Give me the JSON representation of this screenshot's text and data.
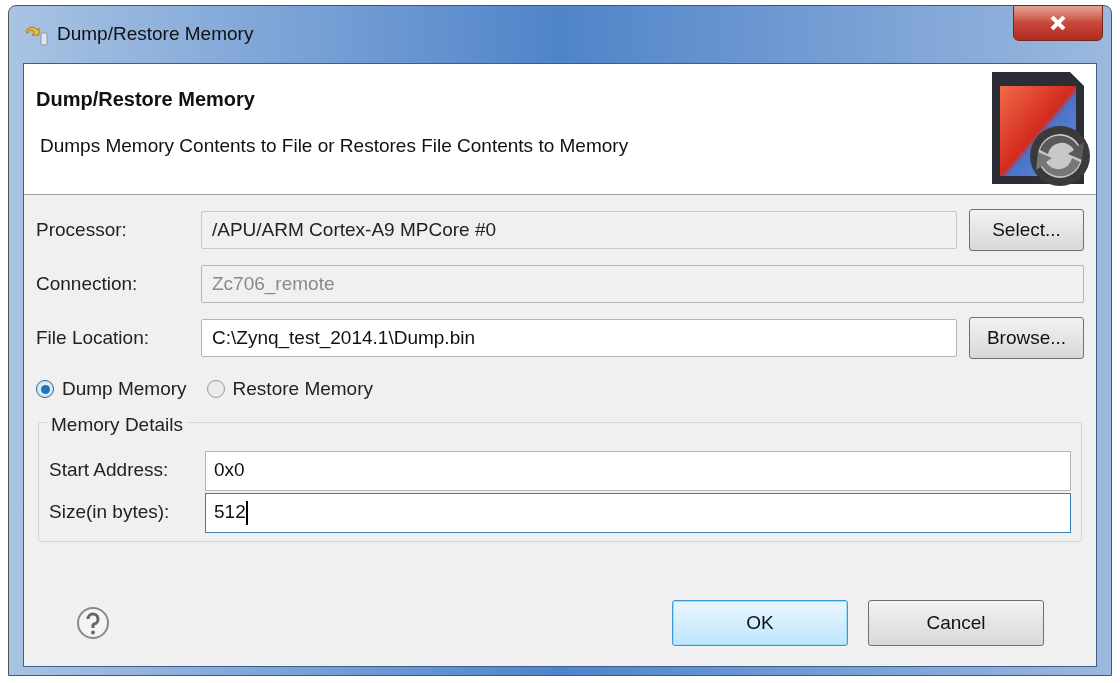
{
  "window": {
    "title": "Dump/Restore Memory"
  },
  "header": {
    "title": "Dump/Restore Memory",
    "description": "Dumps Memory Contents to File or Restores File Contents to Memory"
  },
  "fields": [
    {
      "label": "Processor:",
      "value": "/APU/ARM Cortex-A9 MPCore #0",
      "kind": "readonly",
      "button": "Select..."
    },
    {
      "label": "Connection:",
      "value": "Zc706_remote",
      "kind": "disabled"
    },
    {
      "label": "File Location:",
      "value": "C:\\Zynq_test_2014.1\\Dump.bin",
      "kind": "text",
      "button": "Browse..."
    }
  ],
  "mode": [
    {
      "label": "Dump Memory",
      "selected": true
    },
    {
      "label": "Restore Memory",
      "selected": false
    }
  ],
  "memory_details": {
    "title": "Memory Details",
    "fields": [
      {
        "label": "Start Address:",
        "value": "0x0",
        "focused": false
      },
      {
        "label": "Size(in bytes):",
        "value": "512",
        "focused": true
      }
    ]
  },
  "buttons": [
    {
      "label": "OK",
      "default": true
    },
    {
      "label": "Cancel",
      "default": false
    }
  ]
}
